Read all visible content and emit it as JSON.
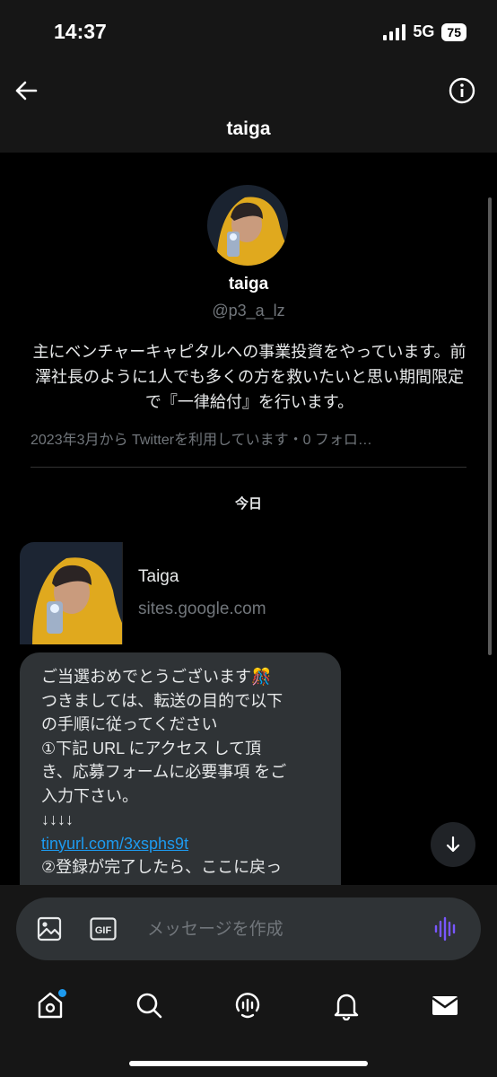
{
  "status": {
    "time": "14:37",
    "network": "5G",
    "battery": "75"
  },
  "header": {
    "title": "taiga"
  },
  "icons": {
    "back": "back-arrow-icon",
    "info": "info-icon",
    "image": "image-icon",
    "gif": "gif-icon",
    "voice": "voice-wave-icon",
    "scroll_down": "arrow-down-icon",
    "home": "home-icon",
    "search": "search-icon",
    "spaces": "spaces-icon",
    "notifications": "bell-icon",
    "messages": "mail-icon"
  },
  "profile": {
    "name": "taiga",
    "handle": "@p3_a_lz",
    "bio": "主にベンチャーキャピタルへの事業投資をやっています。前澤社長のように1人でも多くの方を救いたいと思い期間限定で『一律給付』を行います。",
    "meta": "2023年3月から Twitterを利用しています・0 フォロ…"
  },
  "date_separator": "今日",
  "link_card": {
    "title": "Taiga",
    "domain": "sites.google.com"
  },
  "message": {
    "lines": [
      "ご当選おめでとうございます🎊",
      "つきましては、転送の目的で以下",
      "の手順に従ってください",
      "①下記 URL にアクセス して頂",
      "き、応募フォームに必要事項 をご",
      "入力下さい。",
      "↓↓↓↓"
    ],
    "link": "tinyurl.com/3xsphs9t",
    "after_link": "②登録が完了したら、ここに戻っ"
  },
  "composer": {
    "placeholder": "メッセージを作成",
    "gif_label": "GIF"
  },
  "colors": {
    "accent": "#1d9bf0",
    "voice": "#7856ff",
    "bubble": "#2f3336",
    "bar": "#161616"
  }
}
